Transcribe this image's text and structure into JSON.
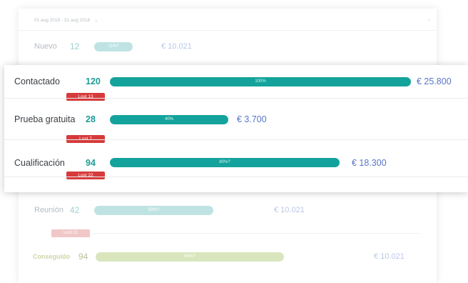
{
  "header": {
    "date_range": "01 aug 2018 - 31 aug 2018"
  },
  "funnel_background": [
    {
      "label": "Nuevo",
      "count": "12",
      "bar_label": "11%?",
      "amount": "€ 10.021",
      "fill": 0.145,
      "color": "#bfe3e3"
    },
    {
      "label": "Reunión",
      "count": "42",
      "bar_label": "59%?",
      "amount": "€ 10.021",
      "fill": 0.45,
      "color": "#bfe3e3",
      "lost": "Lost 22"
    },
    {
      "label": "Conseguido",
      "count": "94",
      "bar_label": "94%?",
      "amount": "€ 10.021",
      "fill": 0.71,
      "color": "#d9e6bd"
    }
  ],
  "funnel": [
    {
      "label": "Contactado",
      "count": "120",
      "bar_label": "100%",
      "amount": "€ 25.800",
      "lost": "Lost 13",
      "fill": 1.0
    },
    {
      "label": "Prueba gratuita",
      "count": "28",
      "bar_label": "40%",
      "amount": "€ 3.700",
      "lost": "Lost 7",
      "fill": 0.394
    },
    {
      "label": "Cualificación",
      "count": "94",
      "bar_label": "80%?",
      "amount": "€ 18.300",
      "lost": "Lost 22",
      "fill": 0.762
    }
  ],
  "colors": {
    "accent": "#14a39c",
    "lost": "#d63a3a",
    "amount": "#5a74c9"
  }
}
